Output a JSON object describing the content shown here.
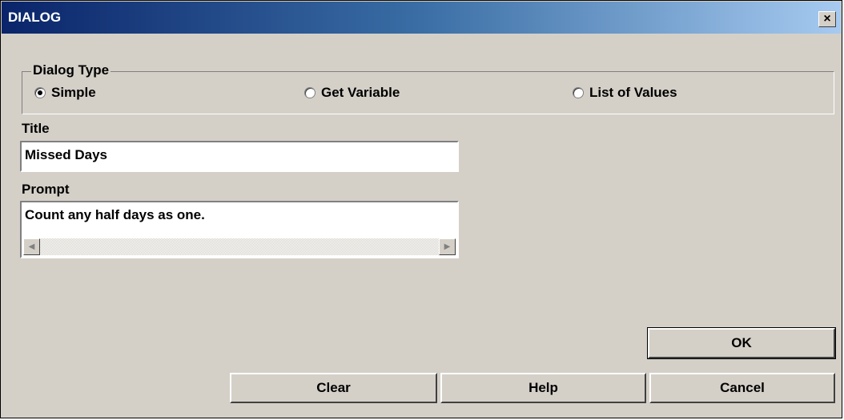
{
  "window": {
    "title": "DIALOG",
    "close_glyph": "✕"
  },
  "dialog_type": {
    "legend": "Dialog Type",
    "options": [
      {
        "label": "Simple",
        "selected": true
      },
      {
        "label": "Get Variable",
        "selected": false
      },
      {
        "label": "List of Values",
        "selected": false
      }
    ]
  },
  "title_field": {
    "label": "Title",
    "value": "Missed Days"
  },
  "prompt_field": {
    "label": "Prompt",
    "value": "Count any half days as one."
  },
  "buttons": {
    "ok": "OK",
    "clear": "Clear",
    "help": "Help",
    "cancel": "Cancel"
  }
}
